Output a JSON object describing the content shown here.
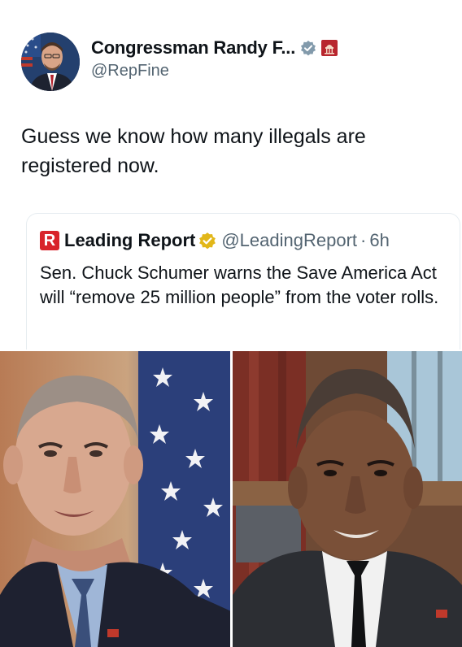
{
  "tweet": {
    "author": {
      "display_name": "Congressman Randy F...",
      "handle": "@RepFine",
      "verified_icon": "gray-check-badge-icon",
      "affiliation_icon": "house-seal-icon"
    },
    "text": "Guess we know how many illegals are registered now."
  },
  "quote": {
    "logo_letter": "R",
    "source_name": "Leading Report",
    "verified_icon": "gold-check-badge-icon",
    "handle": "@LeadingReport",
    "separator": "·",
    "time": "6h",
    "text": "Sen. Chuck Schumer warns the Save America Act will “remove 25 million people” from the voter rolls."
  },
  "media": {
    "left_photo": "politician-portrait-flag-background",
    "right_photo": "politician-portrait-office-background"
  },
  "colors": {
    "text_primary": "#0f1419",
    "text_secondary": "#536471",
    "brand_red": "#d8232a",
    "verified_gold": "#e2b719",
    "verified_gray": "#829aab"
  }
}
